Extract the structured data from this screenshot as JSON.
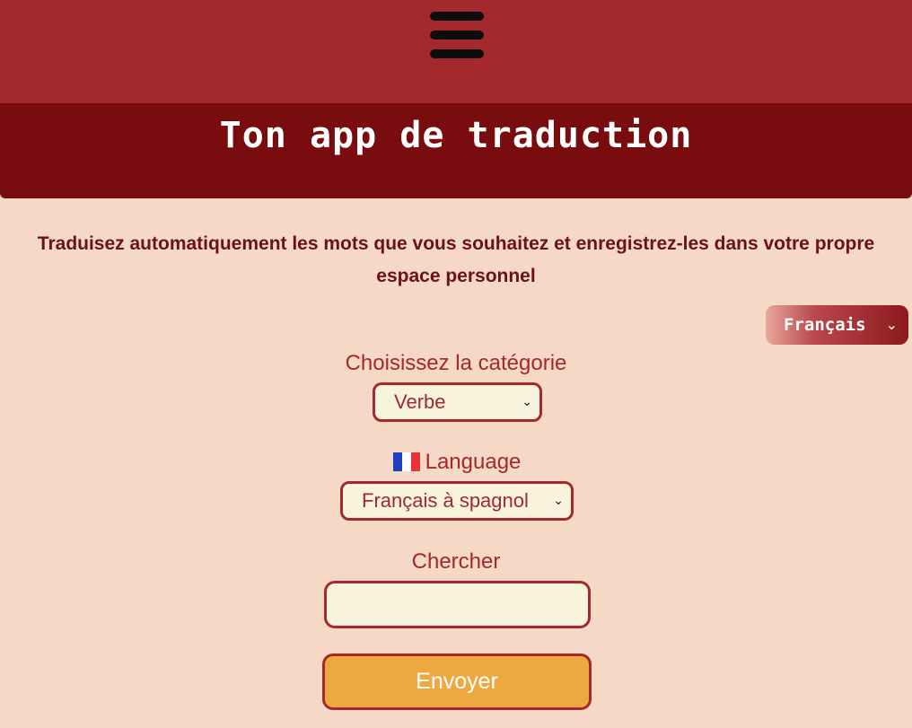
{
  "header": {
    "menu_icon": "hamburger-menu-icon",
    "title": "Ton app de traduction"
  },
  "intro": {
    "text": "Traduisez automatiquement les mots que vous souhaitez et enregistrez-les dans votre propre espace personnel"
  },
  "language_switcher": {
    "selected": "Français",
    "icon": "chevron-down-icon"
  },
  "form": {
    "category": {
      "label": "Choisissez la catégorie",
      "selected": "Verbe"
    },
    "language": {
      "flag_icon": "french-flag-icon",
      "label": "Language",
      "selected": "Français à spagnol"
    },
    "search": {
      "label": "Chercher",
      "value": "",
      "placeholder": ""
    },
    "submit_label": "Envoyer"
  },
  "colors": {
    "background": "#f5d8c6",
    "top_bar": "#a4292c",
    "title_bar": "#780c0e",
    "accent": "#a4292c",
    "input_fill": "#f7f3dc",
    "button_fill": "#eda83f"
  }
}
